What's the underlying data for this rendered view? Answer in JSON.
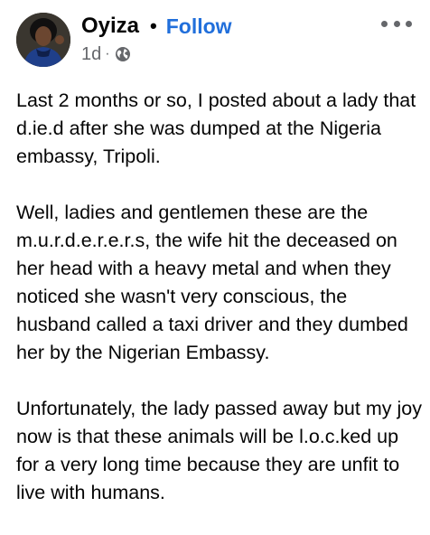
{
  "author": {
    "name": "Oyiza",
    "follow_label": "Follow"
  },
  "meta": {
    "time": "1d",
    "separator": "·",
    "audience_icon": "globe-icon"
  },
  "header": {
    "name_separator": "•",
    "more_icon": "more-options-icon"
  },
  "post": {
    "paragraphs": [
      "Last 2 months or so, I posted about a lady that d.ie.d after she was dumped at the Nigeria embassy, Tripoli.",
      "Well, ladies and gentlemen these are the m.u.r.d.e.r.e.r.s, the wife hit the deceased on her head with a heavy metal and when they noticed she wasn't very conscious, the husband called a taxi driver and they dumbed her by the Nigerian Embassy.",
      "Unfortunately, the lady passed away but my joy now is that these animals will be l.o.c.ked up for a very long time because they are unfit to live with humans."
    ]
  },
  "colors": {
    "follow": "#216fdb",
    "secondary_text": "#65676b",
    "primary_text": "#050505"
  }
}
